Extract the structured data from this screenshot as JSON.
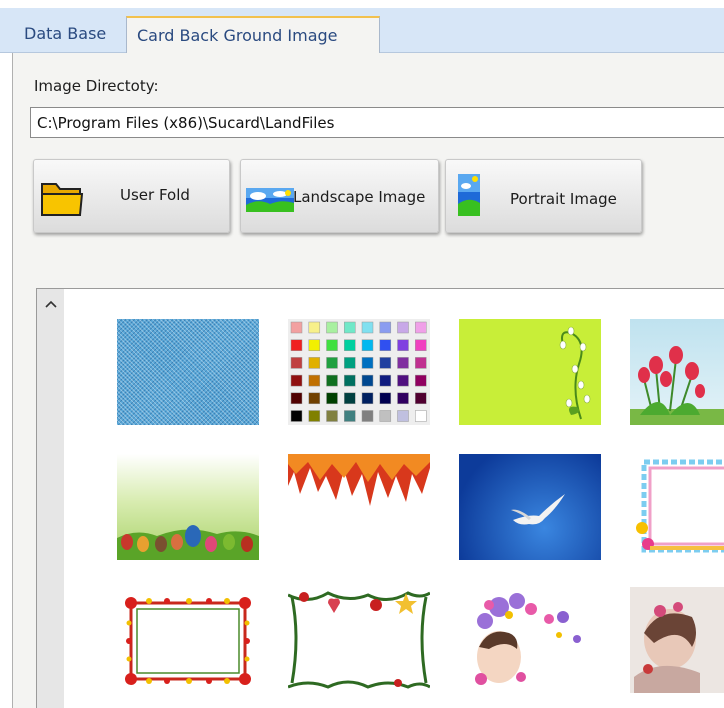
{
  "tabs": [
    {
      "label": "Data Base"
    },
    {
      "label": "Card Back Ground Image"
    }
  ],
  "directory": {
    "label": "Image Directoty:",
    "value": "C:\\Program Files (x86)\\Sucard\\LandFiles"
  },
  "buttons": {
    "user_fold": "User Fold",
    "landscape": "Landscape Image",
    "portrait": "Portrait Image"
  },
  "icons": {
    "folder": "folder-icon",
    "landscape": "landscape-icon",
    "portrait": "portrait-icon",
    "scroll_up": "chevron-up-icon"
  },
  "palette_colors": [
    "#f2a0a0",
    "#f7f08a",
    "#a8f0a0",
    "#70e8c8",
    "#80e0f0",
    "#8a9cf0",
    "#c8a8e8",
    "#f0a0e8",
    "#f02020",
    "#f2f000",
    "#40e040",
    "#00d0a0",
    "#00b8f0",
    "#3050f0",
    "#8040e0",
    "#f040c0",
    "#c04040",
    "#e0b000",
    "#20a040",
    "#00a080",
    "#0070c0",
    "#2040a0",
    "#8030a0",
    "#c03090",
    "#901010",
    "#c07000",
    "#107020",
    "#007060",
    "#004890",
    "#101c80",
    "#501080",
    "#900060",
    "#500000",
    "#704000",
    "#004000",
    "#004040",
    "#002060",
    "#000050",
    "#300060",
    "#500030",
    "#000000",
    "#808000",
    "#808040",
    "#408080",
    "#808080",
    "#c0c0c0",
    "#c0c0e0",
    "#ffffff"
  ]
}
